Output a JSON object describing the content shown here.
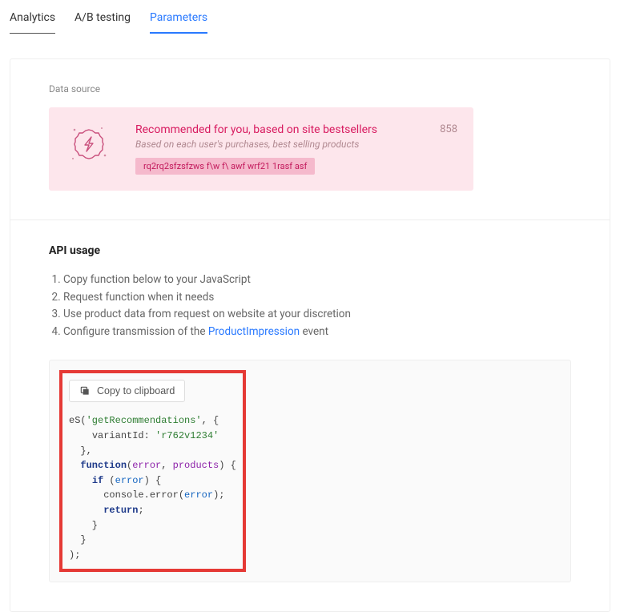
{
  "tabs": {
    "analytics": "Analytics",
    "ab": "A/B testing",
    "params": "Parameters"
  },
  "dataSource": {
    "label": "Data source",
    "title": "Recommended for you, based on site bestsellers",
    "subtitle": "Based on each user's purchases, best selling products",
    "chip": "rq2rq2sfzsfzws f\\w f\\ awf wrf21 1rasf asf",
    "count": "858"
  },
  "api": {
    "heading": "API usage",
    "steps": {
      "s1": "Copy function below to your JavaScript",
      "s2": "Request function when it needs",
      "s3": "Use product data from request on website at your discretion",
      "s4a": "Configure transmission of the ",
      "s4link": "ProductImpression",
      "s4b": " event"
    },
    "copyLabel": "Copy to clipboard",
    "code": {
      "fn": "eS",
      "getRec": "'getRecommendations'",
      "variantKey": "variantId",
      "variantVal": "'r762v1234'",
      "funcKw": "function",
      "errArg": "error",
      "prodArg": "products",
      "ifKw": "if",
      "consoleErr": "console.error",
      "retKw": "return"
    }
  }
}
